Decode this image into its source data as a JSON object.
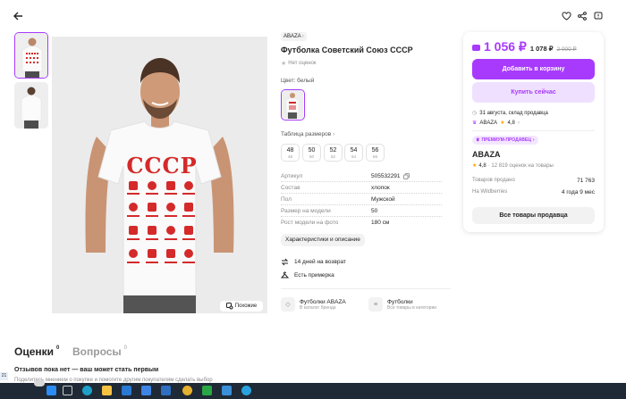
{
  "header": {
    "back_icon": "arrow-left-icon",
    "favorite_icon": "heart-icon",
    "share_icon": "share-icon",
    "report_icon": "report-icon"
  },
  "product": {
    "brand_badge": "ABAZA",
    "title": "Футболка Советский Союз СССР",
    "rating_text": "Нет оценок",
    "color_label": "Цвет: белый",
    "size_table_link": "Таблица размеров",
    "sizes": [
      {
        "size": "48",
        "ru": "48"
      },
      {
        "size": "50",
        "ru": "50"
      },
      {
        "size": "52",
        "ru": "52"
      },
      {
        "size": "54",
        "ru": "54"
      },
      {
        "size": "56",
        "ru": "56"
      }
    ],
    "shirt_print": "СССР",
    "similar_button": "Похожие"
  },
  "specs": [
    {
      "label": "Артикул",
      "value": "505532291"
    },
    {
      "label": "Состав",
      "value": "хлопок"
    },
    {
      "label": "Пол",
      "value": "Мужской"
    },
    {
      "label": "Размер на модели",
      "value": "50"
    },
    {
      "label": "Рост модели на фото",
      "value": "180 см"
    }
  ],
  "specs_button": "Характеристики и описание",
  "features": [
    {
      "icon": "return-icon",
      "text": "14 дней на возврат"
    },
    {
      "icon": "hanger-icon",
      "text": "Есть примерка"
    }
  ],
  "links": [
    {
      "title": "Футболки ABAZA",
      "subtitle": "В каталог бренда"
    },
    {
      "title": "Футболки",
      "subtitle": "Все товары в категории"
    }
  ],
  "buy_card": {
    "price": "1 056 ₽",
    "old_price_1": "1 078 ₽",
    "old_price_2": "2 000 ₽",
    "add_to_cart": "Добавить в корзину",
    "buy_now": "Купить сейчас",
    "delivery": "31 августа, склад продавца",
    "seller_short": "ABAZA",
    "seller_short_rating": "4,8",
    "premium_badge": "ПРЕМИУМ-ПРОДАВЕЦ",
    "seller_name": "ABAZA",
    "seller_rating": "4,8",
    "seller_reviews": "· 12 819 оценок на товары",
    "sold_label": "Товаров продано",
    "sold_value": "71 763",
    "on_wb_label": "На Wildberries",
    "on_wb_value": "4 года 9 мес",
    "all_goods_button": "Все товары продавца"
  },
  "reviews": {
    "tab_reviews": "Оценки",
    "tab_reviews_count": "0",
    "tab_questions": "Вопросы",
    "tab_questions_count": "0",
    "empty_title": "Отзывов пока нет — ваш может стать первым",
    "empty_subtitle": "Поделитесь мнением о покупке и помогите другим покупателям сделать выбор"
  },
  "taskbar": {
    "left_badge": "21"
  },
  "colors": {
    "accent": "#a73afd",
    "accent_light": "#f0e0ff",
    "price": "#a73afd",
    "taskbar": "#1f2a36",
    "print_red": "#d42a2a"
  }
}
